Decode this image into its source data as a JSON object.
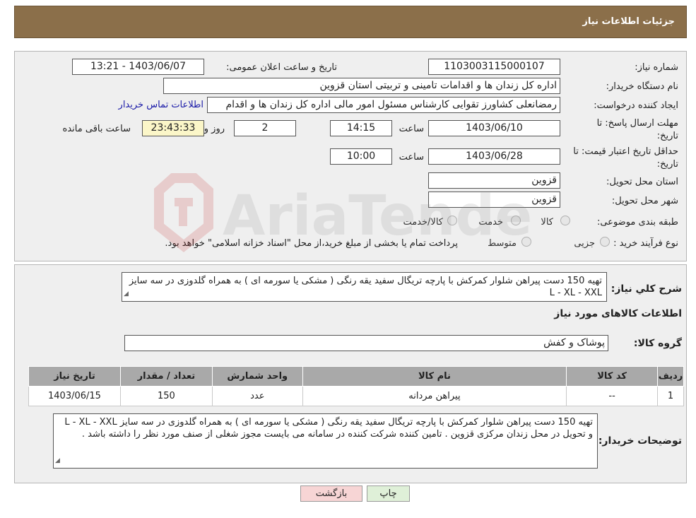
{
  "header": {
    "title": "جزئیات اطلاعات نیاز"
  },
  "form": {
    "need_number_label": "شماره نیاز:",
    "need_number": "1103003115000107",
    "announce_label": "تاریخ و ساعت اعلان عمومی:",
    "announce_value": "1403/06/07 - 13:21",
    "buyer_org_label": "نام دستگاه خریدار:",
    "buyer_org": "اداره کل زندان ها و اقدامات تامینی و تربیتی استان قزوین",
    "requester_label": "ایجاد کننده درخواست:",
    "requester": "رمضانعلی کشاورز تقوایی کارشناس مسئول امور مالی  اداره کل زندان ها و اقدام",
    "contact_link": "اطلاعات تماس خریدار",
    "deadline_label_1": "مهلت ارسال پاسخ: تا",
    "deadline_label_2": "تاریخ:",
    "deadline_date": "1403/06/10",
    "time_label": "ساعت",
    "deadline_time": "14:15",
    "days_value": "2",
    "days_label": "روز و",
    "remaining_time": "23:43:33",
    "remaining_label": "ساعت باقی مانده",
    "validity_label_1": "حداقل تاریخ اعتبار قیمت: تا",
    "validity_label_2": "تاریخ:",
    "validity_date": "1403/06/28",
    "validity_time": "10:00",
    "province_label": "استان محل تحویل:",
    "province": "قزوین",
    "city_label": "شهر محل تحویل:",
    "city": "قزوین",
    "category_label": "طبقه بندی موضوعی:",
    "category_options": [
      "کالا",
      "خدمت",
      "کالا/خدمت"
    ],
    "process_label": "نوع فرآیند خرید :",
    "process_options": [
      "جزیی",
      "متوسط"
    ],
    "process_note": "پرداخت تمام یا بخشی از مبلغ خرید،از محل \"اسناد خزانه اسلامی\" خواهد بود."
  },
  "summary": {
    "label": "شرح کلي نياز:",
    "text": "تهیه 150 دست پیراهن شلوار کمرکش با پارچه تریگال سفید یقه رنگی ( مشکی یا سورمه ای ) به همراه گلدوزی در سه سایز  L - XL - XXL",
    "items_title": "اطلاعات کالاهای مورد نياز",
    "group_label": "گروه کالا:",
    "group_value": "پوشاک و کفش"
  },
  "table": {
    "headers": [
      "رديف",
      "کد کالا",
      "نام کالا",
      "واحد شمارش",
      "تعداد / مقدار",
      "تاريخ نياز"
    ],
    "rows": [
      [
        "1",
        "--",
        "پیراهن مردانه",
        "عدد",
        "150",
        "1403/06/15"
      ]
    ]
  },
  "buyer_notes": {
    "label": "توضیحات خریدار:",
    "text": "تهیه 150 دست پیراهن شلوار کمرکش با پارچه تریگال سفید یقه رنگی ( مشکی یا سورمه ای ) به همراه گلدوزی در سه سایز  L - XL - XXL و تحویل در محل زندان مرکزی قزوین . تامین کننده شرکت کننده در سامانه می بایست مجوز شغلی از صنف مورد نظر را داشته باشد ."
  },
  "buttons": {
    "print": "چاپ",
    "back": "بازگشت"
  },
  "watermark": {
    "text": "AriaTender.neT"
  },
  "colors": {
    "header_bg": "#8b6f4a",
    "panel_bg": "#efefef",
    "back_btn": "#f7d5d5",
    "print_btn": "#dff0d8",
    "link": "#1a1aa8"
  }
}
